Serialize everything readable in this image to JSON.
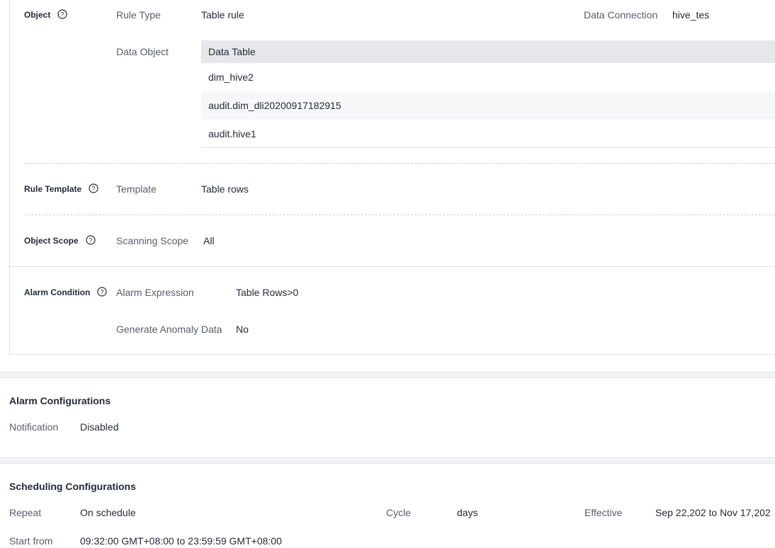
{
  "object_section": {
    "label": "Object",
    "rule_type_label": "Rule Type",
    "rule_type_value": "Table rule",
    "data_connection_label": "Data Connection",
    "data_connection_value": "hive_tes",
    "data_object_label": "Data Object",
    "table_header": "Data Table",
    "tables": [
      "dim_hive2",
      "audit.dim_dli20200917182915",
      "audit.hive1"
    ]
  },
  "rule_template_section": {
    "label": "Rule Template",
    "template_label": "Template",
    "template_value": "Table rows"
  },
  "object_scope_section": {
    "label": "Object Scope",
    "scanning_scope_label": "Scanning Scope",
    "scanning_scope_value": "All"
  },
  "alarm_condition_section": {
    "label": "Alarm Condition",
    "alarm_expression_label": "Alarm Expression",
    "alarm_expression_value": "Table Rows>0",
    "generate_anomaly_label": "Generate Anomaly Data",
    "generate_anomaly_value": "No"
  },
  "alarm_configurations": {
    "title": "Alarm Configurations",
    "notification_label": "Notification",
    "notification_value": "Disabled"
  },
  "scheduling_configurations": {
    "title": "Scheduling Configurations",
    "repeat_label": "Repeat",
    "repeat_value": "On schedule",
    "cycle_label": "Cycle",
    "cycle_value": "days",
    "effective_label": "Effective",
    "effective_value": "Sep 22,202 to Nov 17,202",
    "start_from_label": "Start from",
    "start_from_value": "09:32:00 GMT+08:00 to 23:59:59 GMT+08:00"
  },
  "icons": {
    "help": "help-circle-icon"
  },
  "colors": {
    "text": "#252b3a",
    "label": "#575d6c",
    "header_bg": "#e6e7ea",
    "alt_row_bg": "#f6f7f9"
  }
}
